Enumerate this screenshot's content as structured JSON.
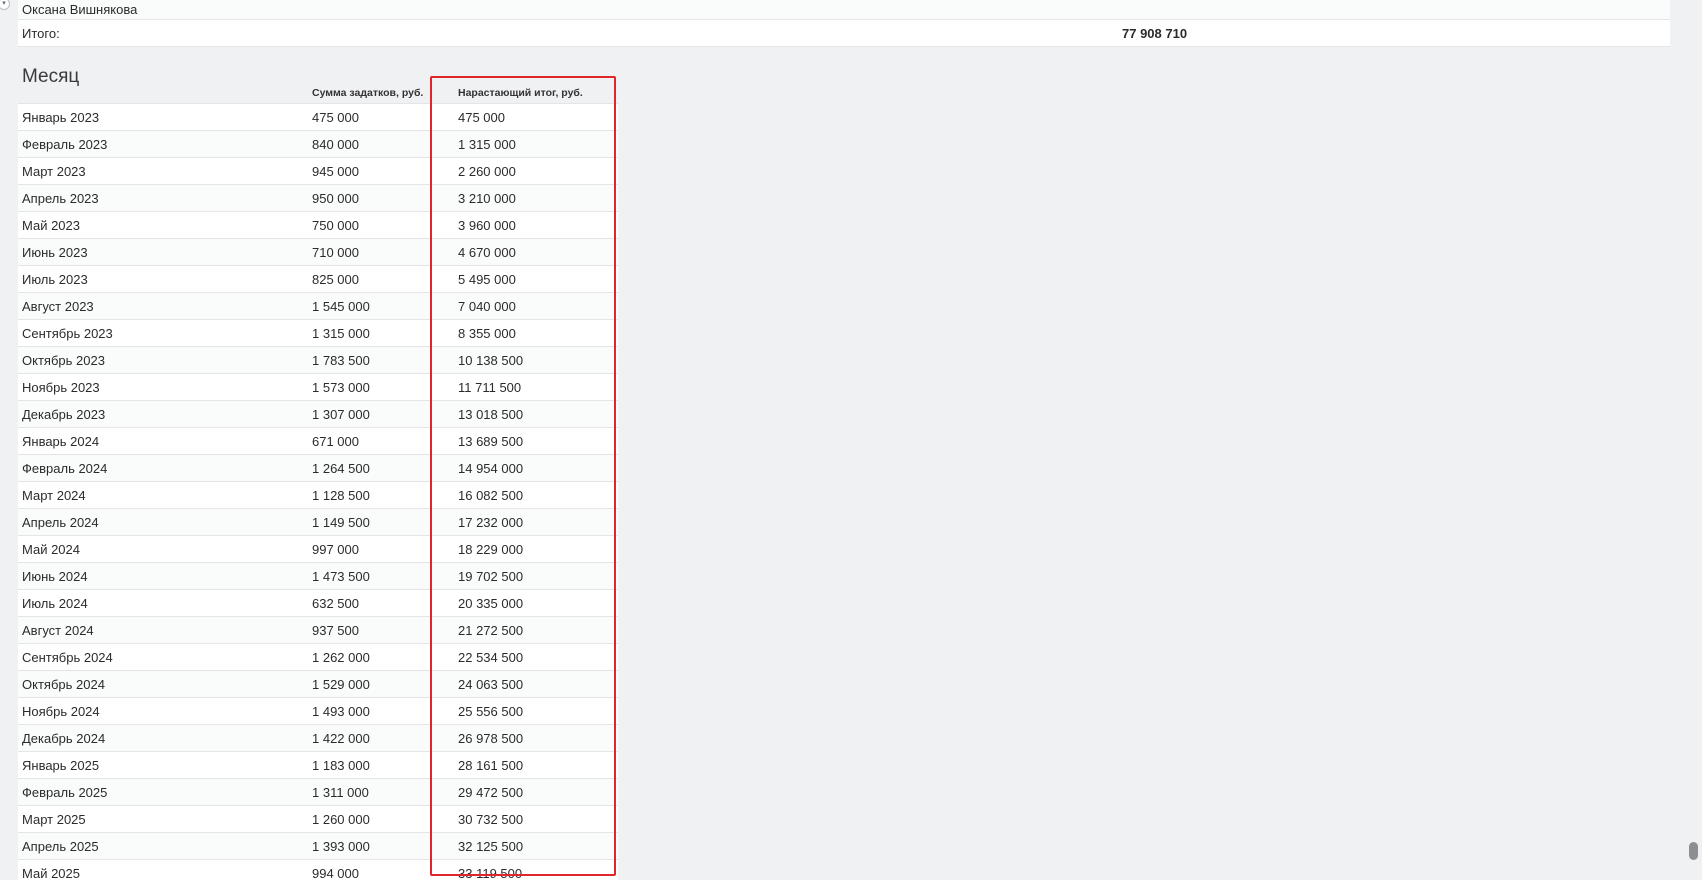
{
  "summary": {
    "prev_person": "Оксана Вишнякова",
    "total_label": "Итого:",
    "total_value": "77 908 710"
  },
  "month_section": {
    "title": "Месяц",
    "col_sum": "Сумма задатков, руб.",
    "col_running": "Нарастающий итог, руб."
  },
  "rows": [
    {
      "month": "Январь 2023",
      "sum": "475 000",
      "running": "475 000"
    },
    {
      "month": "Февраль 2023",
      "sum": "840 000",
      "running": "1 315 000"
    },
    {
      "month": "Март 2023",
      "sum": "945 000",
      "running": "2 260 000"
    },
    {
      "month": "Апрель 2023",
      "sum": "950 000",
      "running": "3 210 000"
    },
    {
      "month": "Май 2023",
      "sum": "750 000",
      "running": "3 960 000"
    },
    {
      "month": "Июнь 2023",
      "sum": "710 000",
      "running": "4 670 000"
    },
    {
      "month": "Июль 2023",
      "sum": "825 000",
      "running": "5 495 000"
    },
    {
      "month": "Август 2023",
      "sum": "1 545 000",
      "running": "7 040 000"
    },
    {
      "month": "Сентябрь 2023",
      "sum": "1 315 000",
      "running": "8 355 000"
    },
    {
      "month": "Октябрь 2023",
      "sum": "1 783 500",
      "running": "10 138 500"
    },
    {
      "month": "Ноябрь 2023",
      "sum": "1 573 000",
      "running": "11 711 500"
    },
    {
      "month": "Декабрь 2023",
      "sum": "1 307 000",
      "running": "13 018 500"
    },
    {
      "month": "Январь 2024",
      "sum": "671 000",
      "running": "13 689 500"
    },
    {
      "month": "Февраль 2024",
      "sum": "1 264 500",
      "running": "14 954 000"
    },
    {
      "month": "Март 2024",
      "sum": "1 128 500",
      "running": "16 082 500"
    },
    {
      "month": "Апрель 2024",
      "sum": "1 149 500",
      "running": "17 232 000"
    },
    {
      "month": "Май 2024",
      "sum": "997 000",
      "running": "18 229 000"
    },
    {
      "month": "Июнь 2024",
      "sum": "1 473 500",
      "running": "19 702 500"
    },
    {
      "month": "Июль 2024",
      "sum": "632 500",
      "running": "20 335 000"
    },
    {
      "month": "Август 2024",
      "sum": "937 500",
      "running": "21 272 500"
    },
    {
      "month": "Сентябрь 2024",
      "sum": "1 262 000",
      "running": "22 534 500"
    },
    {
      "month": "Октябрь 2024",
      "sum": "1 529 000",
      "running": "24 063 500"
    },
    {
      "month": "Ноябрь 2024",
      "sum": "1 493 000",
      "running": "25 556 500"
    },
    {
      "month": "Декабрь 2024",
      "sum": "1 422 000",
      "running": "26 978 500"
    },
    {
      "month": "Январь 2025",
      "sum": "1 183 000",
      "running": "28 161 500"
    },
    {
      "month": "Февраль 2025",
      "sum": "1 311 000",
      "running": "29 472 500"
    },
    {
      "month": "Март 2025",
      "sum": "1 260 000",
      "running": "30 732 500"
    },
    {
      "month": "Апрель 2025",
      "sum": "1 393 000",
      "running": "32 125 500"
    },
    {
      "month": "Май 2025",
      "sum": "994 000",
      "running": "33 119 500"
    }
  ],
  "colors": {
    "highlight": "#e0262b",
    "background": "#f0f1f3",
    "row_alt": "#fafbfb"
  }
}
